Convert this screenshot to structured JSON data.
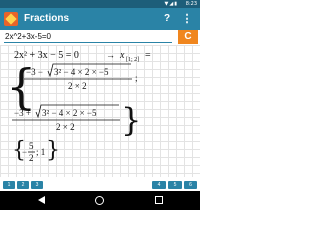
{
  "status_bar": {
    "time": "8:23",
    "signal_icon": "cellular-signal-icon",
    "battery_icon": "battery-icon"
  },
  "app_bar": {
    "title": "Fractions",
    "help_label": "?",
    "menu_label": "⋮",
    "logo_icon": "app-logo-icon"
  },
  "input": {
    "value": "2x^2+3x-5=0",
    "clear_label": "C"
  },
  "result": {
    "equation": "2x² + 3x − 5 = 0",
    "arrow": "→",
    "solution_var": "x",
    "solution_sub": "[1; 2]",
    "eq_sign": "=",
    "root1_numer_prefix": "−3 −",
    "root2_numer_prefix": "−3 +",
    "radicand": "3² − 4 × 2 × −5",
    "denominator": "2 × 2",
    "final_set": "{−5/2; 1}",
    "final_neg": "−",
    "final_num": "5",
    "final_den": "2",
    "final_rest": "; 1",
    "open_brace": "{",
    "close_brace": "}"
  },
  "toolbar": {
    "buttons": [
      {
        "name": "toolbar-button-1",
        "label": "1"
      },
      {
        "name": "toolbar-button-2",
        "label": "2"
      },
      {
        "name": "toolbar-button-3",
        "label": "3"
      },
      {
        "name": "toolbar-button-4",
        "label": "4"
      },
      {
        "name": "toolbar-button-5",
        "label": "5"
      },
      {
        "name": "toolbar-button-6",
        "label": "6"
      }
    ]
  },
  "nav": {
    "back_icon": "back-icon",
    "home_icon": "home-icon",
    "recent_icon": "recent-apps-icon"
  }
}
